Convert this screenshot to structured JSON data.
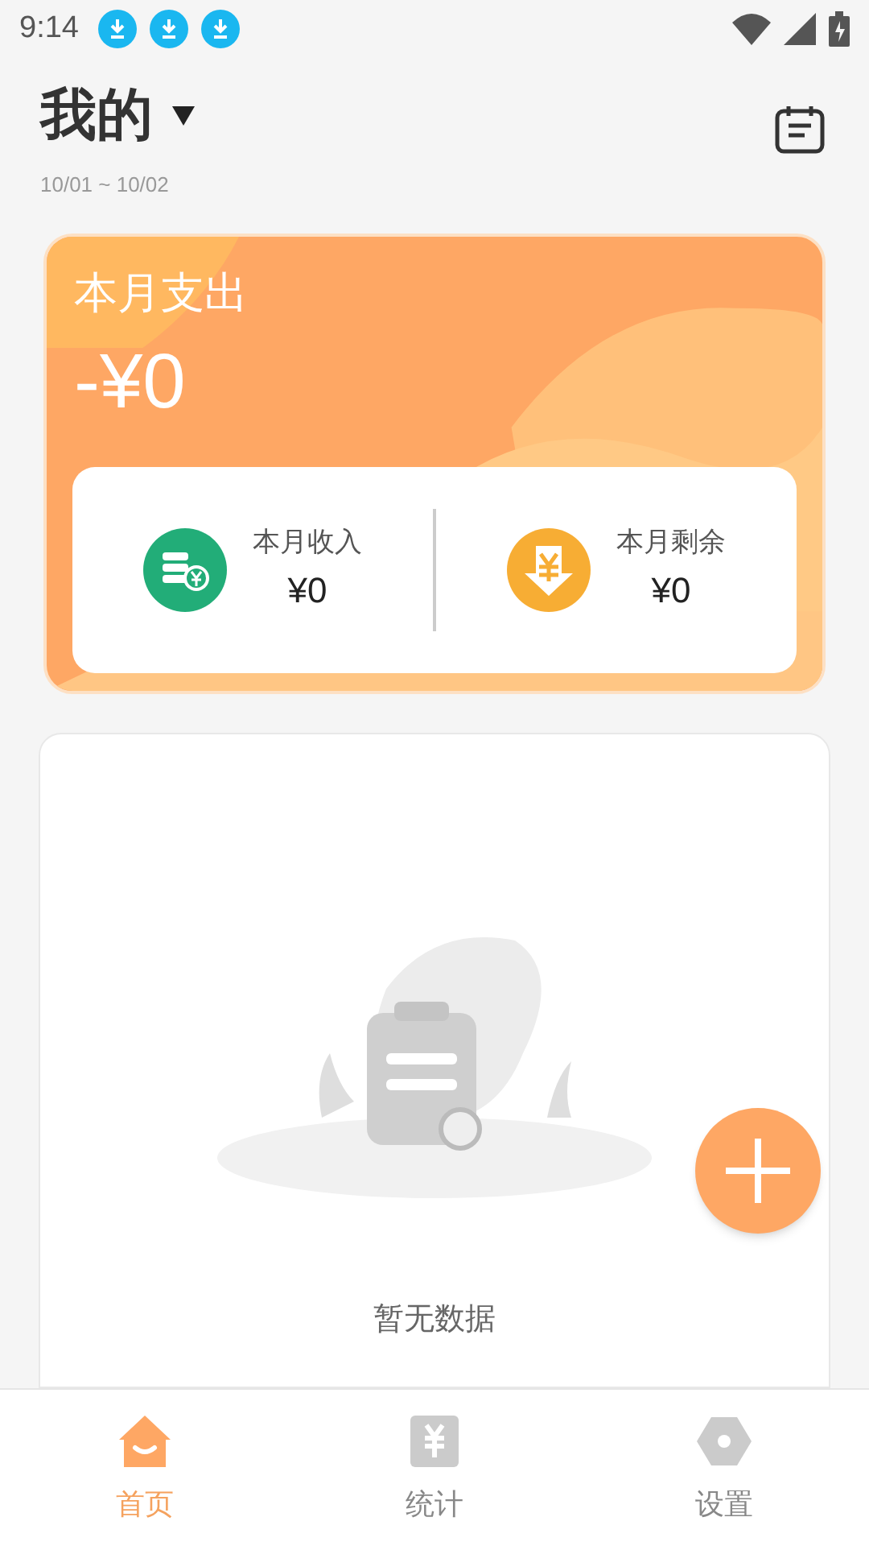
{
  "status_bar": {
    "time": "9:14",
    "notifications": [
      {
        "kind": "download"
      },
      {
        "kind": "download"
      },
      {
        "kind": "download"
      }
    ]
  },
  "header": {
    "title": "我的",
    "date_range": "10/01 ~ 10/02"
  },
  "summary": {
    "label": "本月支出",
    "amount": "-¥0",
    "items": [
      {
        "kind": "income",
        "label": "本月收入",
        "amount": "¥0"
      },
      {
        "kind": "balance",
        "label": "本月剩余",
        "amount": "¥0"
      }
    ]
  },
  "empty_state": {
    "message": "暂无数据"
  },
  "tabs": [
    {
      "kind": "home",
      "label": "首页",
      "selected": true
    },
    {
      "kind": "stats",
      "label": "统计",
      "selected": false
    },
    {
      "kind": "settings",
      "label": "设置",
      "selected": false
    }
  ]
}
